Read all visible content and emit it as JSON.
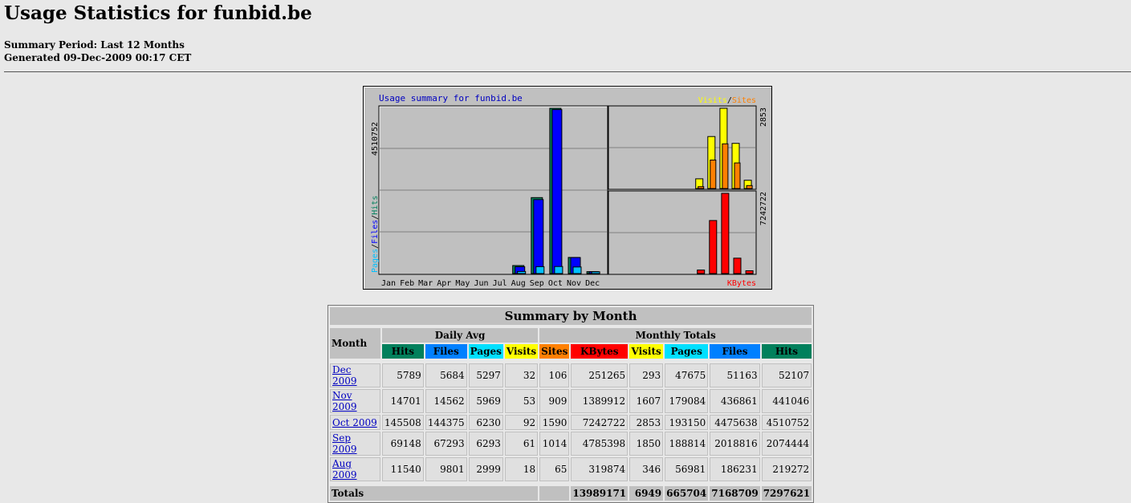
{
  "header": {
    "title": "Usage Statistics for funbid.be",
    "summary_period": "Summary Period: Last 12 Months",
    "generated": "Generated 09-Dec-2009 00:17 CET"
  },
  "chart": {
    "title": "Usage summary for funbid.be",
    "legend_visits": "Visits",
    "legend_sep": "/",
    "legend_sites": "Sites",
    "left_axis_max": "4510752",
    "left_axis_pages": "Pages",
    "left_axis_files": "Files",
    "left_axis_hits": "Hits",
    "right_top_max": "2853",
    "right_bottom_max": "7242722",
    "kbytes_label": "KBytes",
    "colors": {
      "hits": "#00805c",
      "files": "#0000ff",
      "pages": "#00c0ff",
      "visits": "#ffff00",
      "sites": "#ff8000",
      "kbytes": "#ff0000"
    }
  },
  "chart_data": {
    "type": "bar",
    "categories": [
      "Jan",
      "Feb",
      "Mar",
      "Apr",
      "May",
      "Jun",
      "Jul",
      "Aug",
      "Sep",
      "Oct",
      "Nov",
      "Dec"
    ],
    "series": [
      {
        "name": "Hits",
        "values": [
          0,
          0,
          0,
          0,
          0,
          0,
          0,
          219272,
          2074444,
          4510752,
          441046,
          52107
        ]
      },
      {
        "name": "Files",
        "values": [
          0,
          0,
          0,
          0,
          0,
          0,
          0,
          186231,
          2018816,
          4475638,
          436861,
          51163
        ]
      },
      {
        "name": "Pages",
        "values": [
          0,
          0,
          0,
          0,
          0,
          0,
          0,
          56981,
          188814,
          193150,
          179084,
          47675
        ]
      },
      {
        "name": "Visits",
        "values": [
          0,
          0,
          0,
          0,
          0,
          0,
          0,
          346,
          1850,
          2853,
          1607,
          293
        ]
      },
      {
        "name": "Sites",
        "values": [
          0,
          0,
          0,
          0,
          0,
          0,
          0,
          65,
          1014,
          1590,
          909,
          106
        ]
      },
      {
        "name": "KBytes",
        "values": [
          0,
          0,
          0,
          0,
          0,
          0,
          0,
          319874,
          4785398,
          7242722,
          1389912,
          251265
        ]
      }
    ],
    "ylim_hits": [
      0,
      4510752
    ],
    "ylim_visits": [
      0,
      2853
    ],
    "ylim_kbytes": [
      0,
      7242722
    ]
  },
  "table": {
    "title": "Summary by Month",
    "daily_avg": "Daily Avg",
    "monthly_totals": "Monthly Totals",
    "month_header": "Month",
    "columns": {
      "hits": "Hits",
      "files": "Files",
      "pages": "Pages",
      "visits": "Visits",
      "sites": "Sites",
      "kbytes": "KBytes"
    },
    "rows": [
      {
        "month": "Dec 2009",
        "d_hits": "5789",
        "d_files": "5684",
        "d_pages": "5297",
        "d_visits": "32",
        "sites": "106",
        "kbytes": "251265",
        "visits": "293",
        "pages": "47675",
        "files": "51163",
        "hits": "52107"
      },
      {
        "month": "Nov 2009",
        "d_hits": "14701",
        "d_files": "14562",
        "d_pages": "5969",
        "d_visits": "53",
        "sites": "909",
        "kbytes": "1389912",
        "visits": "1607",
        "pages": "179084",
        "files": "436861",
        "hits": "441046"
      },
      {
        "month": "Oct 2009",
        "d_hits": "145508",
        "d_files": "144375",
        "d_pages": "6230",
        "d_visits": "92",
        "sites": "1590",
        "kbytes": "7242722",
        "visits": "2853",
        "pages": "193150",
        "files": "4475638",
        "hits": "4510752"
      },
      {
        "month": "Sep 2009",
        "d_hits": "69148",
        "d_files": "67293",
        "d_pages": "6293",
        "d_visits": "61",
        "sites": "1014",
        "kbytes": "4785398",
        "visits": "1850",
        "pages": "188814",
        "files": "2018816",
        "hits": "2074444"
      },
      {
        "month": "Aug 2009",
        "d_hits": "11540",
        "d_files": "9801",
        "d_pages": "2999",
        "d_visits": "18",
        "sites": "65",
        "kbytes": "319874",
        "visits": "346",
        "pages": "56981",
        "files": "186231",
        "hits": "219272"
      }
    ],
    "totals": {
      "label": "Totals",
      "kbytes": "13989171",
      "visits": "6949",
      "pages": "665704",
      "files": "7168709",
      "hits": "7297621"
    }
  }
}
